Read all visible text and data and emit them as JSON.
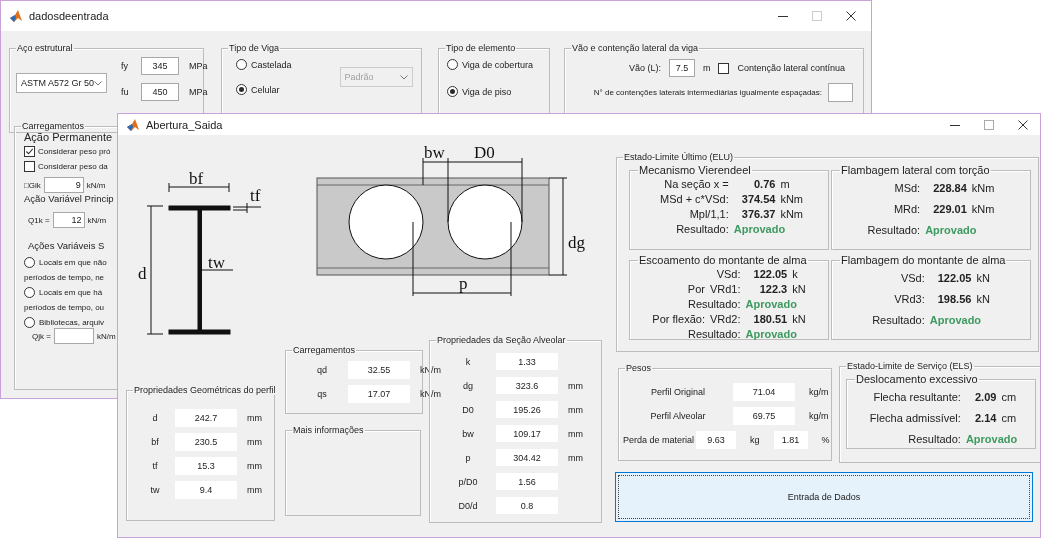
{
  "back_window": {
    "title": "dadosdeentrada",
    "aco_estrutural": {
      "title": "Aço estrutural",
      "steel": "ASTM A572 Gr 50",
      "fy_label": "fy",
      "fy": "345",
      "fy_unit": "MPa",
      "fu_label": "fu",
      "fu": "450",
      "fu_unit": "MPa"
    },
    "tipo_de_viga": {
      "title": "Tipo de Viga",
      "options": [
        {
          "label": "Castelada",
          "selected": false
        },
        {
          "label": "Celular",
          "selected": true
        }
      ],
      "pattern": {
        "value": "Padrão",
        "disabled": true
      }
    },
    "tipo_de_elemento": {
      "title": "Tipo de elemento",
      "options": [
        {
          "label": "Viga de cobertura",
          "selected": false
        },
        {
          "label": "Viga de piso",
          "selected": true
        }
      ]
    },
    "vao": {
      "title": "Vão e contenção lateral da viga",
      "span_label": "Vão (L):",
      "span": "7.5",
      "span_unit": "m",
      "continuous": {
        "label": "Contenção lateral contínua",
        "checked": false
      },
      "restraints_label": "N° de contenções laterais intermediárias igualmente espaçadas:"
    },
    "carregamentos": {
      "title": "Carregamentos",
      "permanent_heading": "Ação Permanente",
      "checks": [
        {
          "label": "Considerar peso pró",
          "checked": true
        },
        {
          "label": "Considerar peso da",
          "checked": false
        }
      ],
      "gik_label": "□Gik",
      "gik": "9",
      "gik_unit": "kN/m",
      "variable_heading": "Ação Variável Princip",
      "q1k_label": "Q1k =",
      "q1k": "12",
      "q1k_unit": "kN/m",
      "secondary_heading": "Ações Variáveis S",
      "options": [
        {
          "label": "Locais em que não",
          "continuation": "períodos de tempo, ne",
          "selected": false
        },
        {
          "label": "Locais em que há",
          "continuation": "períodos de tempo, ou",
          "selected": false
        },
        {
          "label": "Bibliotecas, arquiv",
          "selected": false
        }
      ],
      "qjk_label": "Qjk =",
      "qjk_unit": "kN/m"
    }
  },
  "front_window": {
    "title": "Abertura_Saida",
    "profile_drawing": {
      "bf": "bf",
      "tf": "tf",
      "tw": "tw",
      "d": "d"
    },
    "beam_drawing": {
      "bw": "bw",
      "D0": "D0",
      "dg": "dg",
      "p": "p"
    },
    "geometric": {
      "title": "Propriedades Geométricas do perfil",
      "rows": [
        {
          "label": "d",
          "value": "242.7",
          "unit": "mm"
        },
        {
          "label": "bf",
          "value": "230.5",
          "unit": "mm"
        },
        {
          "label": "tf",
          "value": "15.3",
          "unit": "mm"
        },
        {
          "label": "tw",
          "value": "9.4",
          "unit": "mm"
        }
      ]
    },
    "loads": {
      "title": "Carregamentos",
      "rows": [
        {
          "label": "qd",
          "value": "32.55",
          "unit": "kN/m"
        },
        {
          "label": "qs",
          "value": "17.07",
          "unit": "kN/m"
        }
      ]
    },
    "more_info": {
      "title": "Mais informações"
    },
    "alveolar": {
      "title": "Propriedades da Seção Alveolar",
      "rows": [
        {
          "label": "k",
          "value": "1.33"
        },
        {
          "label": "dg",
          "value": "323.6",
          "unit": "mm"
        },
        {
          "label": "D0",
          "value": "195.26",
          "unit": "mm"
        },
        {
          "label": "bw",
          "value": "109.17",
          "unit": "mm"
        },
        {
          "label": "p",
          "value": "304.42",
          "unit": "mm"
        },
        {
          "label": "p/D0",
          "value": "1.56"
        },
        {
          "label": "D0/d",
          "value": "0.8"
        }
      ]
    },
    "elu": {
      "title": "Estado-Limite Último (ELU)",
      "groups": [
        {
          "title": "Mecanismo Vierendeel",
          "lines": [
            {
              "kind": "value",
              "label": "Na seção x =",
              "value": "0.76",
              "unit": "m"
            },
            {
              "kind": "value",
              "label": "MSd + c*VSd:",
              "value": "374.54",
              "unit": "kNm"
            },
            {
              "kind": "value",
              "label": "Mpl/1,1:",
              "value": "376.37",
              "unit": "kNm"
            },
            {
              "kind": "result",
              "label": "Resultado:",
              "result": "Aprovado"
            }
          ]
        },
        {
          "title": "Flambagem lateral com torção",
          "lines": [
            {
              "kind": "value",
              "label": "MSd:",
              "value": "228.84",
              "unit": "kNm"
            },
            {
              "kind": "value",
              "label": "MRd:",
              "value": "229.01",
              "unit": "kNm"
            },
            {
              "kind": "result",
              "label": "Resultado:",
              "result": "Aprovado"
            }
          ]
        },
        {
          "title": "Escoamento do montante de alma",
          "lines": [
            {
              "kind": "value",
              "label": "VSd:",
              "value": "122.05",
              "unit": "k"
            },
            {
              "kind": "value",
              "prefix": "Por",
              "label": "VRd1:",
              "value": "122.3",
              "unit": "kN"
            },
            {
              "kind": "result",
              "label": "Resultado:",
              "result": "Aprovado"
            },
            {
              "kind": "value",
              "prefix": "Por flexão:",
              "label": "VRd2:",
              "value": "180.51",
              "unit": "kN"
            },
            {
              "kind": "result",
              "label": "Resultado:",
              "result": "Aprovado"
            }
          ]
        },
        {
          "title": "Flambagem do montante de alma",
          "lines": [
            {
              "kind": "value",
              "label": "VSd:",
              "value": "122.05",
              "unit": "kN"
            },
            {
              "kind": "value",
              "label": "VRd3:",
              "value": "198.56",
              "unit": "kN"
            },
            {
              "kind": "result",
              "label": "Resultado:",
              "result": "Aprovado"
            }
          ]
        }
      ]
    },
    "pesos": {
      "title": "Pesos",
      "rows": [
        {
          "label": "Perfil Original",
          "value": "71.04",
          "unit": "kg/m"
        },
        {
          "label": "Perfil Alveolar",
          "value": "69.75",
          "unit": "kg/m"
        }
      ],
      "loss": {
        "label": "Perda de material",
        "mass": "9.63",
        "mass_unit": "kg",
        "percent": "1.81",
        "percent_unit": "%"
      }
    },
    "els": {
      "title": "Estado-Limite de Serviço (ELS)",
      "group": {
        "title": "Deslocamento excessivo",
        "lines": [
          {
            "kind": "value",
            "label": "Flecha resultante:",
            "value": "2.09",
            "unit": "cm"
          },
          {
            "kind": "value",
            "label": "Flecha admissível:",
            "value": "2.14",
            "unit": "cm"
          },
          {
            "kind": "result",
            "label": "Resultado:",
            "result": "Aprovado"
          }
        ]
      }
    },
    "button": "Entrada de Dados"
  }
}
